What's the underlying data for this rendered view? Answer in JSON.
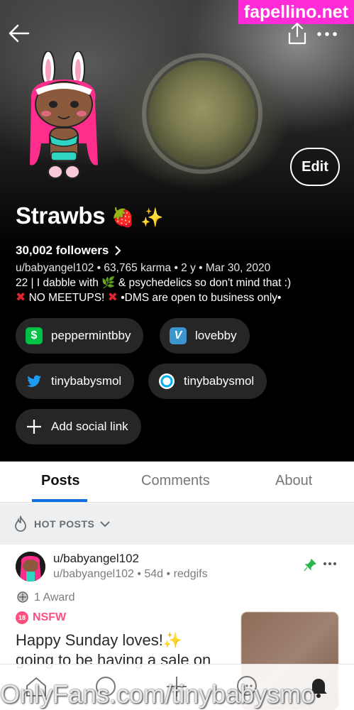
{
  "watermark": {
    "top": "fapellino.net",
    "bottom": "OnlyFans.com/tinybabysmo"
  },
  "profile": {
    "display_name": "Strawbs",
    "followers": "30,002 followers",
    "meta": "u/babyangel102 • 63,765 karma • 2 y • Mar 30, 2020",
    "bio_line1": "22 | I dabble with",
    "bio_line1_end": "& psychedelics so don't mind that :)",
    "bio_line2_mid": "NO MEETUPS!",
    "bio_line2_end": "•DMS are open to business only•",
    "edit_label": "Edit"
  },
  "social_links": [
    {
      "label": "peppermintbby",
      "icon": "cash-app-icon"
    },
    {
      "label": "lovebby",
      "icon": "venmo-icon"
    },
    {
      "label": "tinybabysmol",
      "icon": "twitter-icon"
    },
    {
      "label": "tinybabysmol",
      "icon": "onlyfans-icon"
    },
    {
      "label": "Add social link",
      "icon": "plus-icon"
    }
  ],
  "tabs": [
    {
      "label": "Posts",
      "active": true
    },
    {
      "label": "Comments",
      "active": false
    },
    {
      "label": "About",
      "active": false
    }
  ],
  "sort": {
    "label": "HOT POSTS"
  },
  "post": {
    "user": "u/babyangel102",
    "meta": "u/babyangel102 • 54d • redgifs",
    "award": "1 Award",
    "nsfw_badge": "18",
    "nsfw": "NSFW",
    "title_line1": "Happy Sunday loves!",
    "title_line2": "going to be having a sale on"
  },
  "colors": {
    "accent": "#0f6fde",
    "nsfw": "#ff4f7f",
    "pin": "#2bb44b",
    "watermark_bg": "#ff2bd6"
  }
}
